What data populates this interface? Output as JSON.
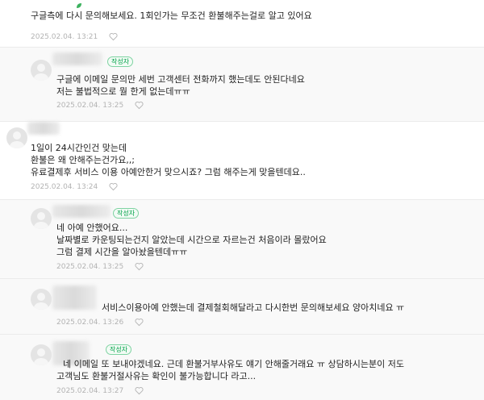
{
  "comments": [
    {
      "lines": [
        "구글측에 다시 문의해보세요. 1회인가는 무조건 환불해주는걸로 알고 있어요"
      ],
      "date": "2025.02.04. 13:21"
    },
    {
      "badge": "작성자",
      "lines": [
        "구글에 이메일 문의만 세번 고객센터 전화까지 했는데도 안된다네요",
        "저는 불법적으로 뭘 한게 없는데ㅠㅠ"
      ],
      "date": "2025.02.04. 13:25"
    },
    {
      "lines": [
        "1일이 24시간인건 맞는데",
        "환불은 왜 안해주는건가요,,;",
        "유료결제후 서비스 이용 아예안한거 맞으시죠? 그럼 해주는게 맞을텐데요.."
      ],
      "date": "2025.02.04. 13:24"
    },
    {
      "badge": "작성자",
      "lines": [
        "네 아예 안했어요...",
        "날짜별로 카운팅되는건지 알았는데 시간으로 자르는건 처음이라 몰랐어요",
        "그럼 결제 시간을 알아놨을텐데ㅠㅠ"
      ],
      "date": "2025.02.04. 13:25"
    },
    {
      "lines": [
        "서비스이용아예 안했는데 결제철회해달라고 다시한번 문의해보세요 양아치네요 ㅠ"
      ],
      "date": "2025.02.04. 13:26"
    },
    {
      "badge": "작성자",
      "lines": [
        "네 이메일 또 보내야겠네요. 근데 환불거부사유도 얘기 안해줄거래요 ㅠ 상담하시는분이 저도",
        "고객님도 환불거절사유는 확인이 불가능합니다 라고..."
      ],
      "date": "2025.02.04. 13:27"
    }
  ],
  "colors": {
    "badge_green": "#00a148",
    "meta_gray": "#b3b3b3"
  },
  "icons": {
    "like": "heart-icon",
    "avatar": "user-avatar-icon"
  }
}
